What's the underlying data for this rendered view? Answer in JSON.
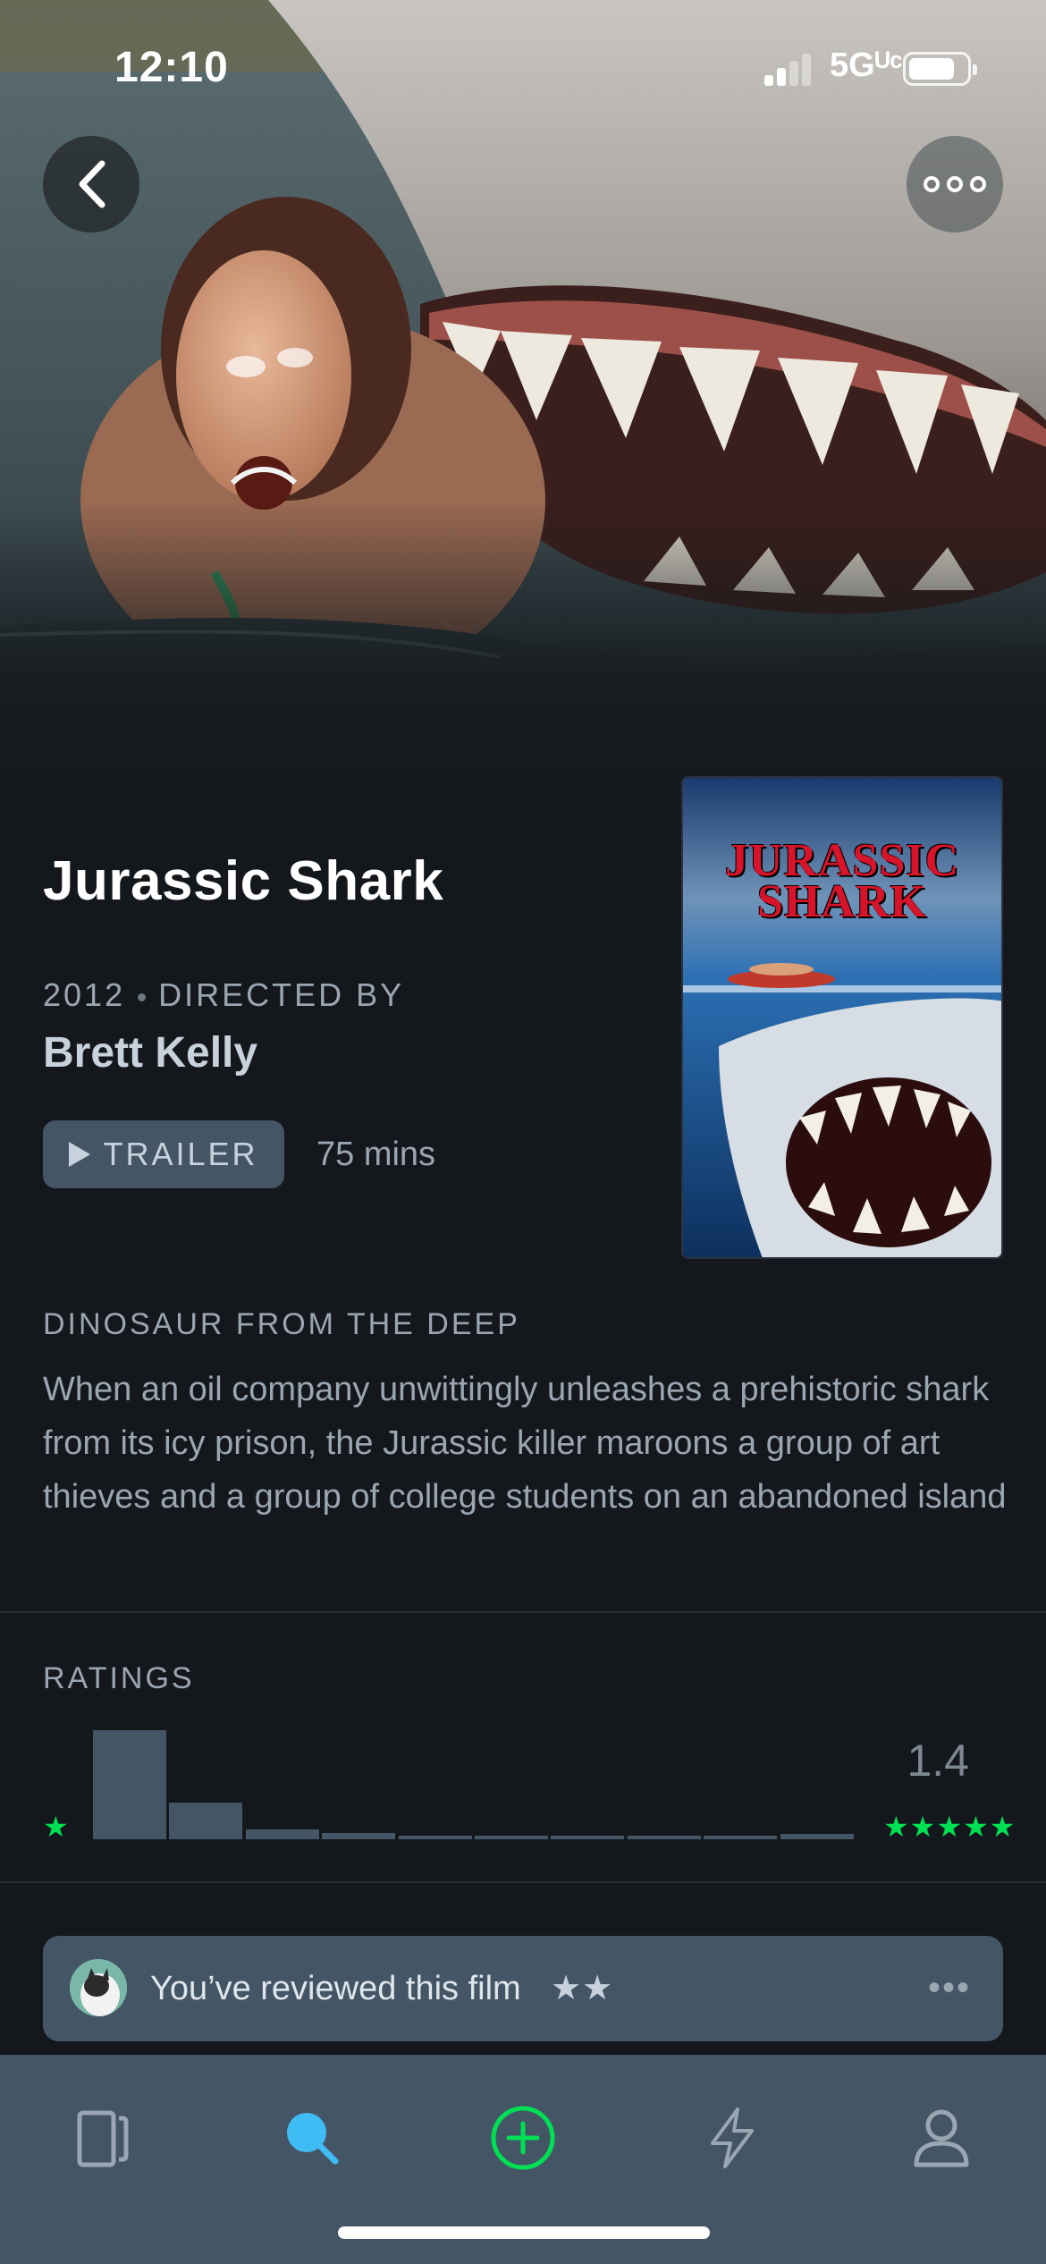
{
  "status_bar": {
    "time": "12:10",
    "network": "5Gᵁᶜ"
  },
  "film": {
    "title": "Jurassic Shark",
    "year": "2012",
    "directed_by_label": "DIRECTED BY",
    "director": "Brett Kelly",
    "trailer_label": "TRAILER",
    "runtime": "75 mins",
    "poster_title_line1": "JURASSIC",
    "poster_title_line2": "SHARK",
    "tagline": "DINOSAUR FROM THE DEEP",
    "synopsis": "When an oil company unwittingly unleashes a prehistoric shark from its icy prison, the Jurassic killer maroons a group of art thieves and a group of college students on an abandoned island"
  },
  "ratings": {
    "label": "RATINGS",
    "average": "1.4",
    "min_star": "★",
    "max_stars": "★★★★★",
    "histogram_fractions": [
      1.0,
      0.34,
      0.09,
      0.06,
      0.03,
      0.03,
      0.03,
      0.03,
      0.03,
      0.05
    ],
    "accent_color": "#00e054"
  },
  "review": {
    "text": "You’ve reviewed this film",
    "stars": "★★",
    "more": "•••"
  },
  "tabs": [
    {
      "name": "films-icon",
      "active": false
    },
    {
      "name": "search-icon",
      "active": true
    },
    {
      "name": "add-icon",
      "active": false
    },
    {
      "name": "activity-icon",
      "active": false
    },
    {
      "name": "profile-icon",
      "active": false
    }
  ],
  "colors": {
    "background": "#14181c",
    "panel": "#445566",
    "search_active": "#40bcf4",
    "add_green": "#00e054"
  }
}
